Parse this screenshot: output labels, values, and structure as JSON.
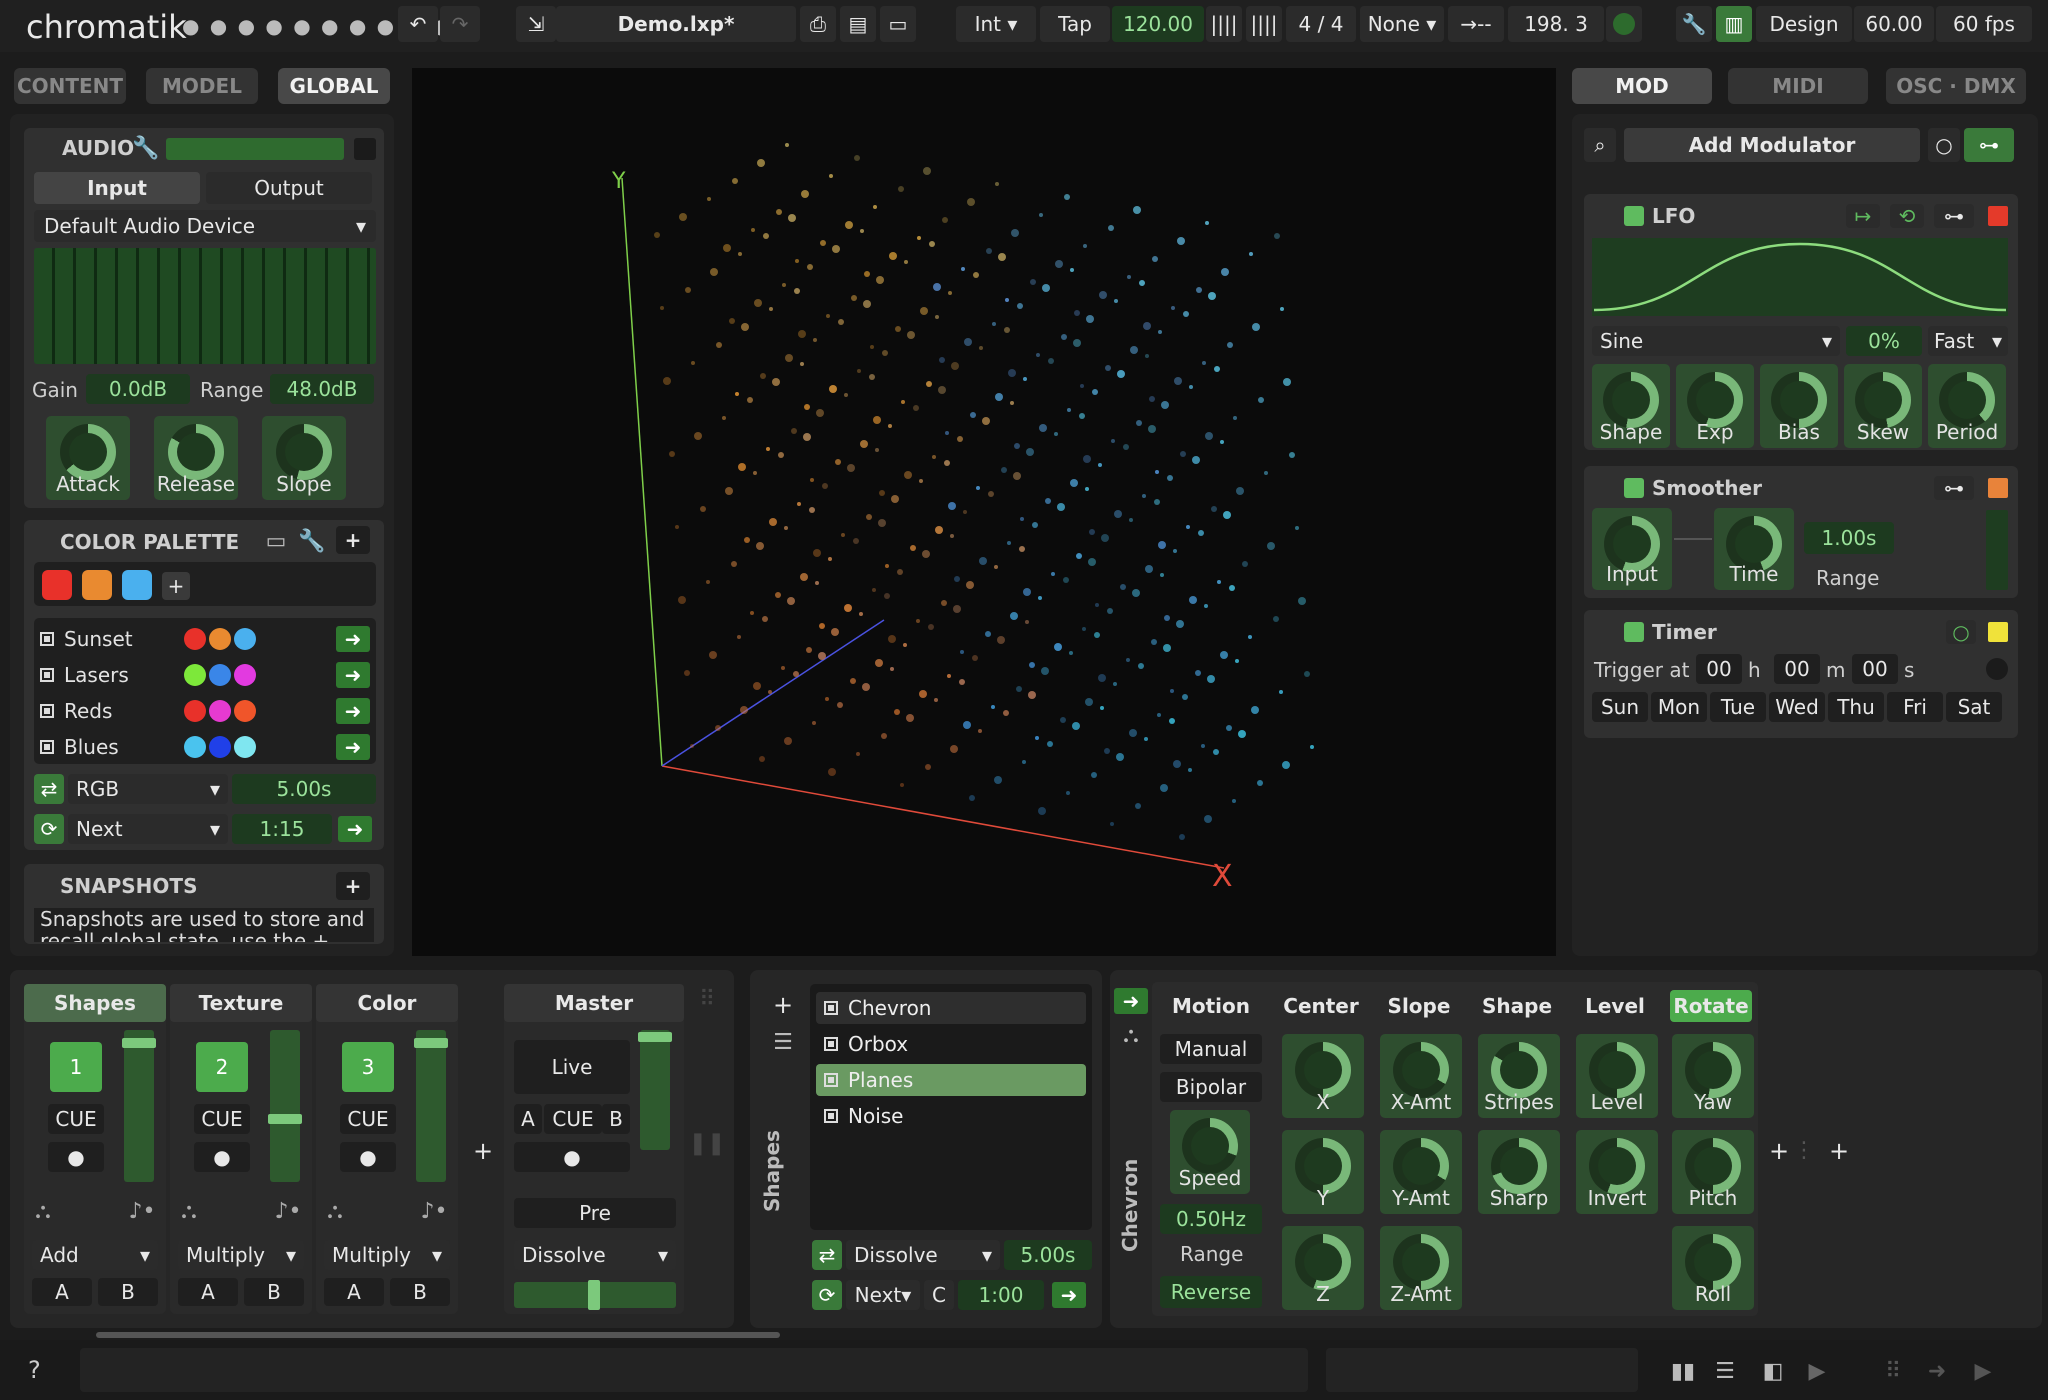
{
  "app": {
    "logo": "chromatik",
    "project": "Demo.lxp*"
  },
  "toolbar": {
    "clock_mode": "Int",
    "tap_label": "Tap",
    "bpm": "120.00",
    "time_signature": "4 / 4",
    "sync": "None",
    "arrow_label": "→--",
    "position": "198. 3",
    "design_label": "Design",
    "fps_value": "60.00",
    "fps_label": "60 fps"
  },
  "left_tabs": [
    "CONTENT",
    "MODEL",
    "GLOBAL"
  ],
  "audio": {
    "title": "AUDIO",
    "tab_input": "Input",
    "tab_output": "Output",
    "device": "Default Audio Device",
    "gain_label": "Gain",
    "gain_value": "0.0dB",
    "range_label": "Range",
    "range_value": "48.0dB",
    "knobs": [
      "Attack",
      "Release",
      "Slope"
    ]
  },
  "palette": {
    "title": "COLOR PALETTE",
    "swatches": [
      "#e8312a",
      "#e98a30",
      "#4ab0ee"
    ],
    "add": "+",
    "items": [
      {
        "name": "Sunset",
        "colors": [
          "#e8312a",
          "#e98a30",
          "#4ab0ee"
        ]
      },
      {
        "name": "Lasers",
        "colors": [
          "#7de83a",
          "#3a86e8",
          "#e23ae0"
        ]
      },
      {
        "name": "Reds",
        "colors": [
          "#e8312a",
          "#e63ad0",
          "#f0552a"
        ]
      },
      {
        "name": "Blues",
        "colors": [
          "#4ac3ee",
          "#2040e8",
          "#7fe6f0"
        ]
      }
    ],
    "mode": "RGB",
    "mode_time": "5.00s",
    "next_label": "Next",
    "next_time": "1:15"
  },
  "snapshots": {
    "title": "SNAPSHOTS",
    "text": "Snapshots are used to store and recall global state, use the +"
  },
  "right_tabs": [
    "MOD",
    "MIDI",
    "OSC · DMX"
  ],
  "modulators": {
    "add_label": "Add Modulator",
    "lfo": {
      "title": "LFO",
      "wave": "Sine",
      "percent": "0%",
      "speed": "Fast",
      "knobs": [
        "Shape",
        "Exp",
        "Bias",
        "Skew",
        "Period"
      ]
    },
    "smoother": {
      "title": "Smoother",
      "knobs": [
        "Input",
        "Time"
      ],
      "time_value": "1.00s",
      "range_label": "Range"
    },
    "timer": {
      "title": "Timer",
      "trigger_label": "Trigger at",
      "h": "00",
      "h_label": "h",
      "m": "00",
      "m_label": "m",
      "s": "00",
      "s_label": "s",
      "days": [
        "Sun",
        "Mon",
        "Tue",
        "Wed",
        "Thu",
        "Fri",
        "Sat"
      ]
    }
  },
  "mixer": {
    "channels": [
      {
        "name": "Shapes",
        "number": "1",
        "cue": "CUE",
        "blend": "Add"
      },
      {
        "name": "Texture",
        "number": "2",
        "cue": "CUE",
        "blend": "Multiply"
      },
      {
        "name": "Color",
        "number": "3",
        "cue": "CUE",
        "blend": "Multiply"
      }
    ],
    "ab": [
      "A",
      "B"
    ],
    "master": {
      "name": "Master",
      "live": "Live",
      "a": "A",
      "cue": "CUE",
      "b": "B",
      "pre": "Pre",
      "transition": "Dissolve"
    }
  },
  "patterns": {
    "side_label": "Shapes",
    "items": [
      "Chevron",
      "Orbox",
      "Planes",
      "Noise"
    ],
    "transition": "Dissolve",
    "transition_time": "5.00s",
    "next": "Next",
    "c": "C",
    "next_time": "1:00"
  },
  "chevron": {
    "side_label": "Chevron",
    "headers": [
      "Motion",
      "Center",
      "Slope",
      "Shape",
      "Level",
      "Rotate"
    ],
    "motion": {
      "manual": "Manual",
      "bipolar": "Bipolar",
      "speed": "Speed",
      "hz": "0.50Hz",
      "range": "Range",
      "reverse": "Reverse"
    },
    "knobs_row1": [
      "X",
      "X-Amt",
      "Stripes",
      "Level",
      "Yaw"
    ],
    "knobs_row2": [
      "Y",
      "Y-Amt",
      "Sharp",
      "Invert",
      "Pitch"
    ],
    "knobs_row3": [
      "Z",
      "Z-Amt",
      "Roll"
    ]
  },
  "status": {
    "help": "?"
  }
}
